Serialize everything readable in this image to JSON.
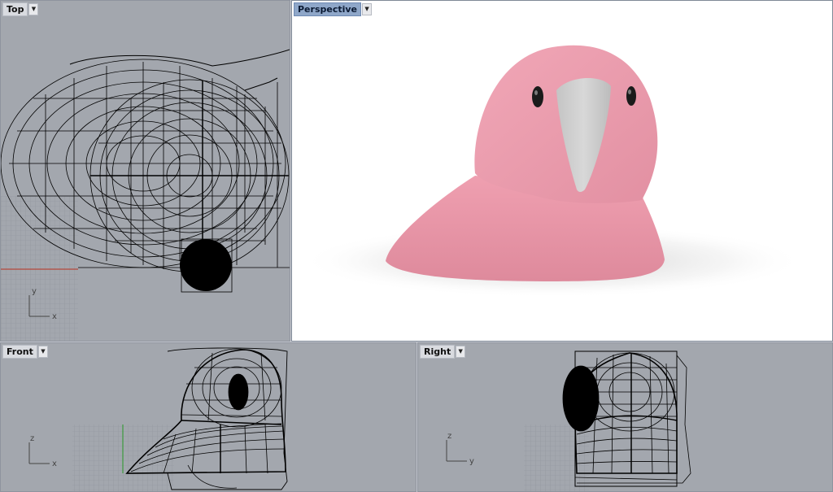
{
  "viewports": {
    "top": {
      "label": "Top",
      "axis_labels": [
        "y",
        "x"
      ]
    },
    "perspective": {
      "label": "Perspective"
    },
    "front": {
      "label": "Front",
      "axis_labels": [
        "z",
        "x"
      ]
    },
    "right": {
      "label": "Right",
      "axis_labels": [
        "z",
        "y"
      ]
    }
  },
  "icons": {
    "menu_caret": "chevron-down-icon"
  },
  "colors": {
    "viewport_bg": "#a3a7ae",
    "perspective_bg": "#ffffff",
    "model_pink": "#e89aaa",
    "beak_gray": "#c9c9c9",
    "wire": "#000000",
    "x_axis": "#b5473b",
    "z_axis": "#3c9a3c"
  }
}
